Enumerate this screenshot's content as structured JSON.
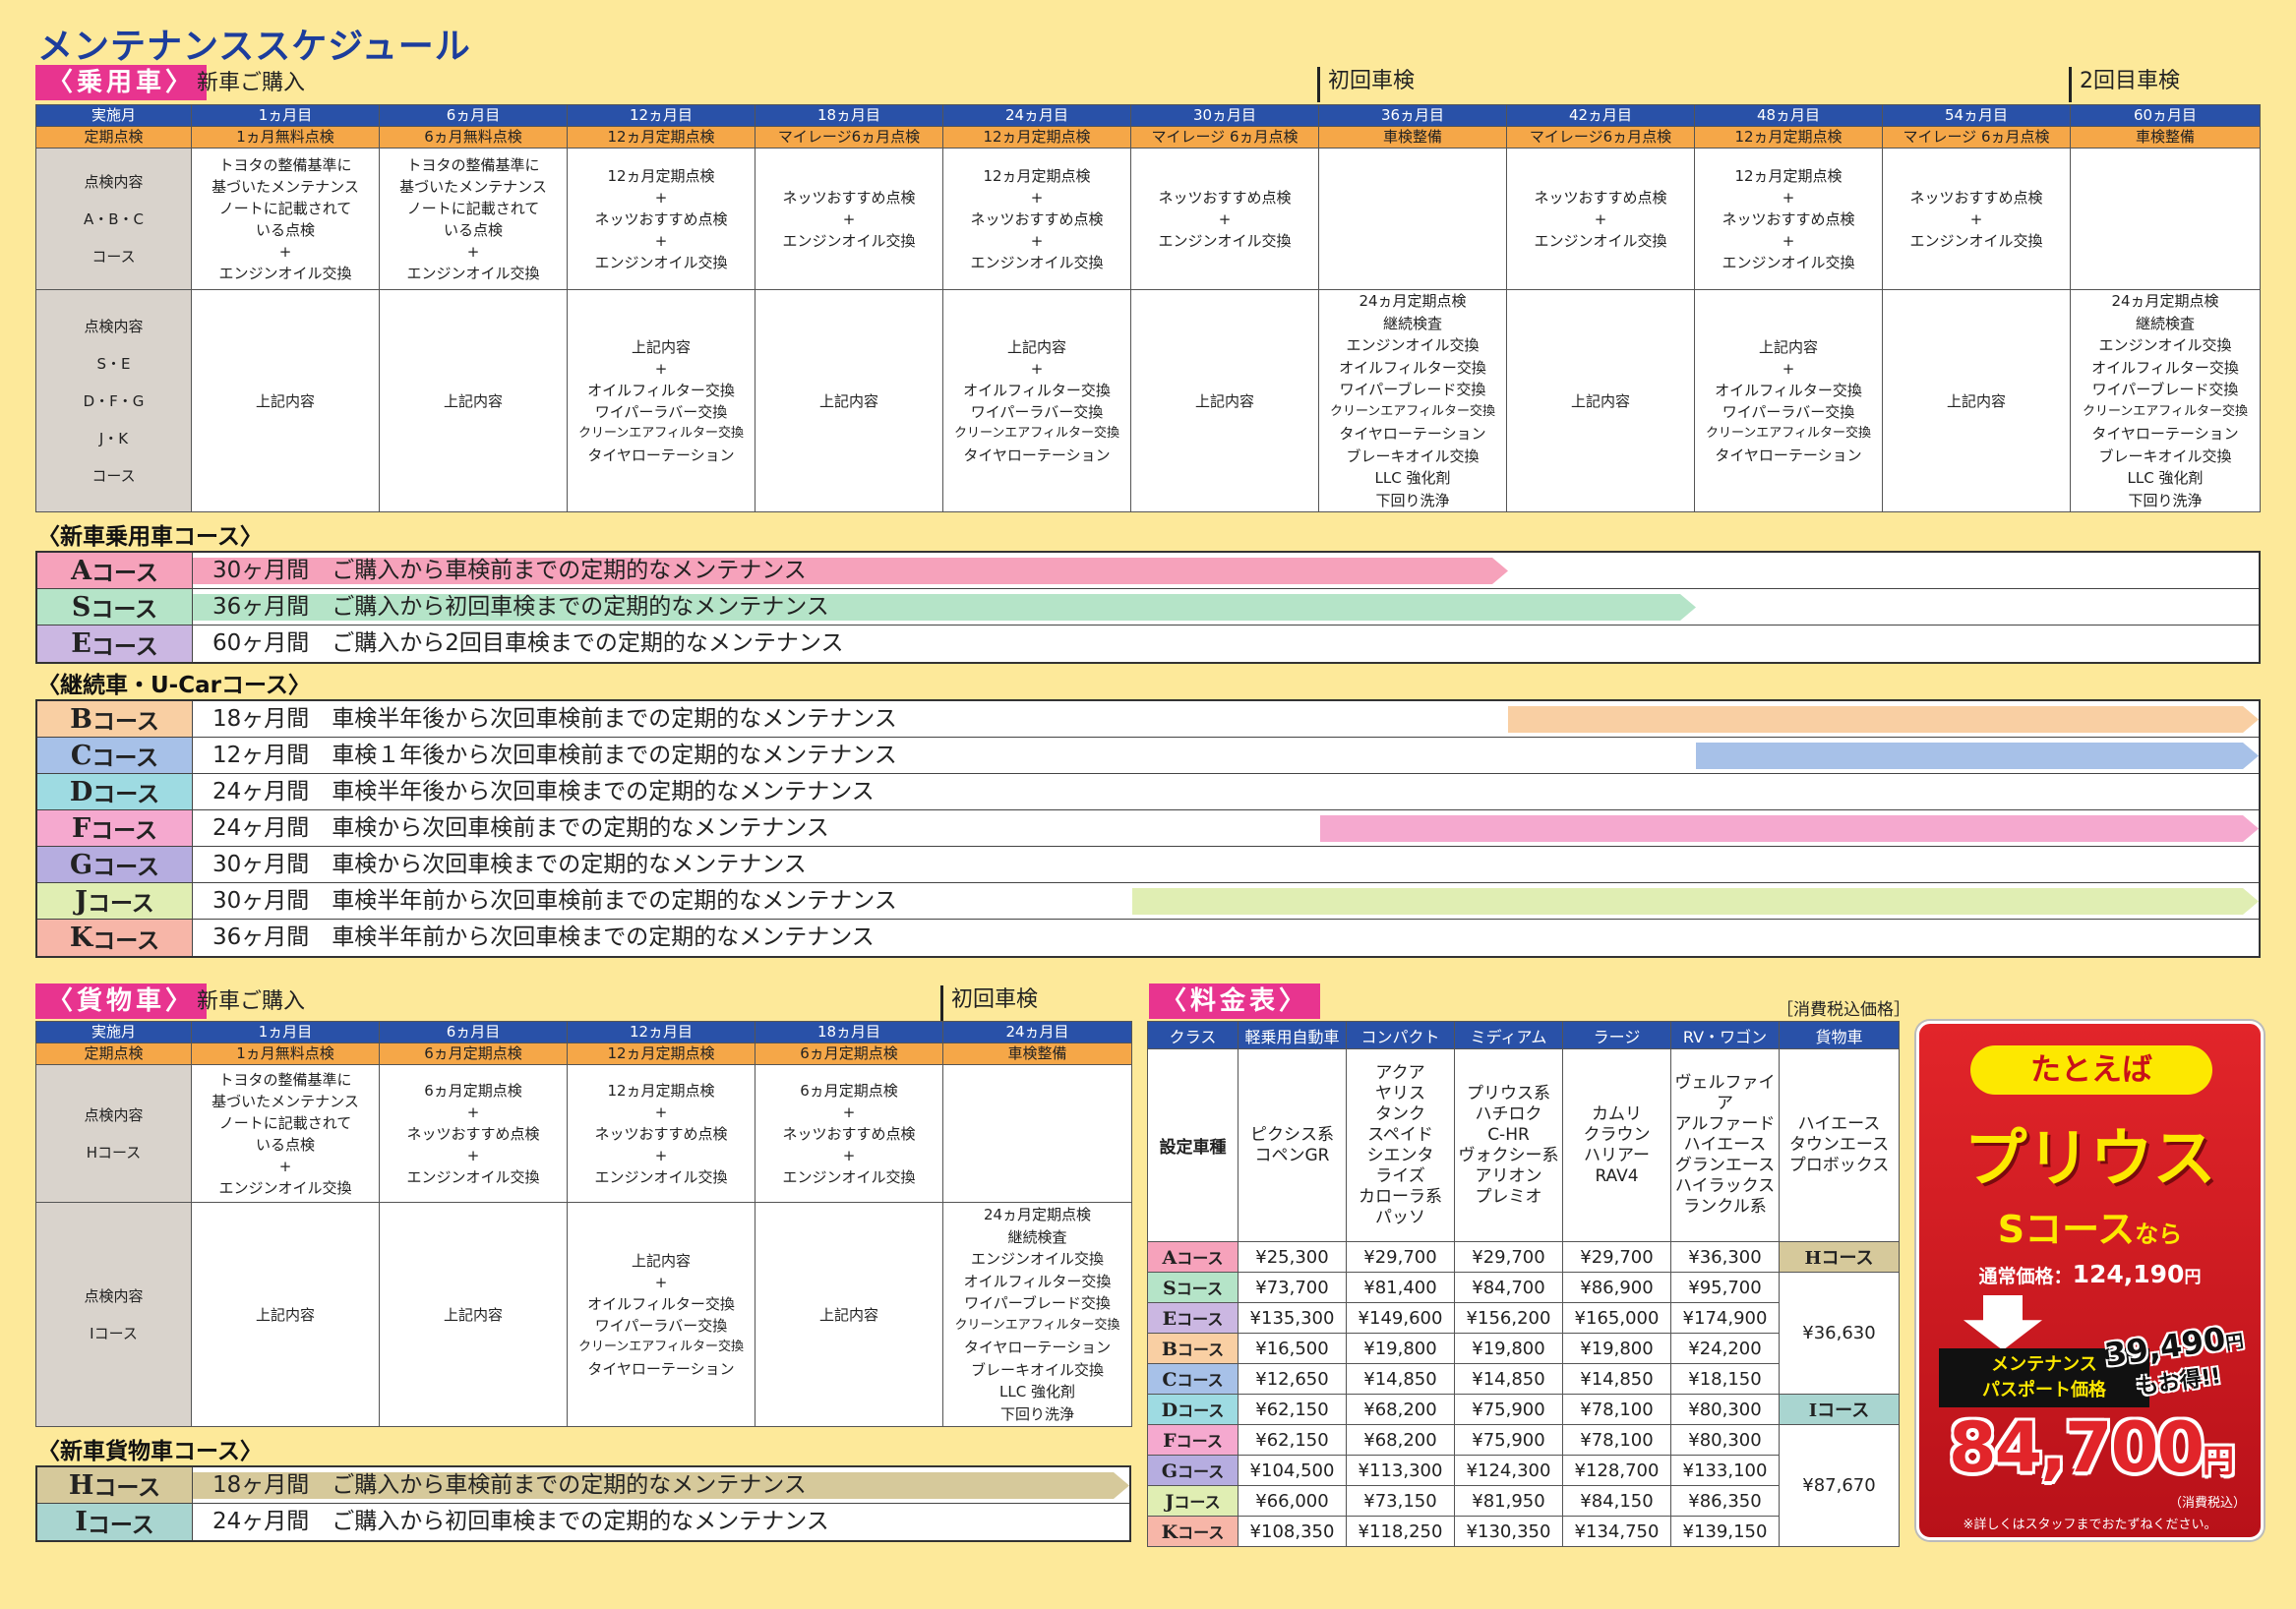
{
  "page_title": "メンテナンススケジュール",
  "passenger": {
    "label": "〈乗用車〉",
    "new_purchase": "新車ご購入",
    "first_inspection": "初回車検",
    "second_inspection": "2回目車検",
    "header_months": [
      "実施月",
      "1ヵ月目",
      "6ヵ月目",
      "12ヵ月目",
      "18ヵ月目",
      "24ヵ月目",
      "30ヵ月目",
      "36ヵ月目",
      "42ヵ月目",
      "48ヵ月目",
      "54ヵ月目",
      "60ヵ月目"
    ],
    "header_types": [
      "定期点検",
      "1ヵ月無料点検",
      "6ヵ月無料点検",
      "12ヵ月定期点検",
      "マイレージ6ヵ月点検",
      "12ヵ月定期点検",
      "マイレージ 6ヵ月点検",
      "車検整備",
      "マイレージ6ヵ月点検",
      "12ヵ月定期点検",
      "マイレージ 6ヵ月点検",
      "車検整備"
    ],
    "row1_label": [
      "点検内容",
      "A・B・C",
      "コース"
    ],
    "row1": [
      [
        "トヨタの整備基準に",
        "基づいたメンテナンス",
        "ノートに記載されて",
        "いる点検",
        "+",
        "エンジンオイル交換"
      ],
      [
        "トヨタの整備基準に",
        "基づいたメンテナンス",
        "ノートに記載されて",
        "いる点検",
        "+",
        "エンジンオイル交換"
      ],
      [
        "12ヵ月定期点検",
        "+",
        "ネッツおすすめ点検",
        "+",
        "エンジンオイル交換"
      ],
      [
        "ネッツおすすめ点検",
        "+",
        "エンジンオイル交換"
      ],
      [
        "12ヵ月定期点検",
        "+",
        "ネッツおすすめ点検",
        "+",
        "エンジンオイル交換"
      ],
      [
        "ネッツおすすめ点検",
        "+",
        "エンジンオイル交換"
      ],
      [],
      [
        "ネッツおすすめ点検",
        "+",
        "エンジンオイル交換"
      ],
      [
        "12ヵ月定期点検",
        "+",
        "ネッツおすすめ点検",
        "+",
        "エンジンオイル交換"
      ],
      [
        "ネッツおすすめ点検",
        "+",
        "エンジンオイル交換"
      ],
      []
    ],
    "row2_label": [
      "点検内容",
      "S・E",
      "D・F・G",
      "J・K",
      "コース"
    ],
    "row2": [
      [
        "上記内容"
      ],
      [
        "上記内容"
      ],
      [
        "上記内容",
        "+",
        "オイルフィルター交換",
        "ワイパーラバー交換",
        "クリーンエアフィルター交換",
        "タイヤローテーション"
      ],
      [
        "上記内容"
      ],
      [
        "上記内容",
        "+",
        "オイルフィルター交換",
        "ワイパーラバー交換",
        "クリーンエアフィルター交換",
        "タイヤローテーション"
      ],
      [
        "上記内容"
      ],
      [
        "24ヵ月定期点検",
        "継続検査",
        "エンジンオイル交換",
        "オイルフィルター交換",
        "ワイパーブレード交換",
        "クリーンエアフィルター交換",
        "タイヤローテーション",
        "ブレーキオイル交換",
        "LLC 強化剤",
        "下回り洗浄"
      ],
      [
        "上記内容"
      ],
      [
        "上記内容",
        "+",
        "オイルフィルター交換",
        "ワイパーラバー交換",
        "クリーンエアフィルター交換",
        "タイヤローテーション"
      ],
      [
        "上記内容"
      ],
      [
        "24ヵ月定期点検",
        "継続検査",
        "エンジンオイル交換",
        "オイルフィルター交換",
        "ワイパーブレード交換",
        "クリーンエアフィルター交換",
        "タイヤローテーション",
        "ブレーキオイル交換",
        "LLC 強化剤",
        "下回り洗浄"
      ]
    ]
  },
  "new_passenger_courses": {
    "heading": "〈新車乗用車コース〉",
    "items": [
      {
        "letter": "A",
        "suffix": "コース",
        "desc": "30ヶ月間　ご購入から車検前までの定期的なメンテナンス",
        "color": "#f6a2bb",
        "from": 0,
        "to": 6
      },
      {
        "letter": "S",
        "suffix": "コース",
        "desc": "36ヶ月間　ご購入から初回車検までの定期的なメンテナンス",
        "color": "#b5e4c8",
        "from": 0,
        "to": 7
      },
      {
        "letter": "E",
        "suffix": "コース",
        "desc": "60ヶ月間　ご購入から2回目車検までの定期的なメンテナンス",
        "color": "#cbb7e2",
        "from": 0,
        "to": 11
      }
    ]
  },
  "continuing_courses": {
    "heading": "〈継続車・U-Carコース〉",
    "items": [
      {
        "letter": "B",
        "suffix": "コース",
        "desc": "18ヶ月間　車検半年後から次回車検前までの定期的なメンテナンス",
        "color": "#f9cfa3",
        "from": 7,
        "to": 10
      },
      {
        "letter": "C",
        "suffix": "コース",
        "desc": "12ヶ月間　車検１年後から次回車検前までの定期的なメンテナンス",
        "color": "#a7c1e8",
        "from": 8,
        "to": 10
      },
      {
        "letter": "D",
        "suffix": "コース",
        "desc": "24ヶ月間　車検半年後から次回車検までの定期的なメンテナンス",
        "color": "#9edbe2",
        "from": 7,
        "to": 11
      },
      {
        "letter": "F",
        "suffix": "コース",
        "desc": "24ヶ月間　車検から次回車検前までの定期的なメンテナンス",
        "color": "#f5a9cf",
        "from": 6,
        "to": 10
      },
      {
        "letter": "G",
        "suffix": "コース",
        "desc": "30ヶ月間　車検から次回車検までの定期的なメンテナンス",
        "color": "#b6ade0",
        "from": 6,
        "to": 11
      },
      {
        "letter": "J",
        "suffix": "コース",
        "desc": "30ヶ月間　車検半年前から次回車検前までの定期的なメンテナンス",
        "color": "#e0eeb3",
        "from": 5,
        "to": 10
      },
      {
        "letter": "K",
        "suffix": "コース",
        "desc": "36ヶ月間　車検半年前から次回車検までの定期的なメンテナンス",
        "color": "#f7b6a8",
        "from": 5,
        "to": 11
      }
    ]
  },
  "cargo": {
    "label": "〈貨物車〉",
    "new_purchase": "新車ご購入",
    "first_inspection": "初回車検",
    "header_months": [
      "実施月",
      "1ヵ月目",
      "6ヵ月目",
      "12ヵ月目",
      "18ヵ月目",
      "24ヵ月目"
    ],
    "header_types": [
      "定期点検",
      "1ヵ月無料点検",
      "6ヵ月定期点検",
      "12ヵ月定期点検",
      "6ヵ月定期点検",
      "車検整備"
    ],
    "row1_label": [
      "点検内容",
      "Hコース"
    ],
    "row1": [
      [
        "トヨタの整備基準に",
        "基づいたメンテナンス",
        "ノートに記載されて",
        "いる点検",
        "+",
        "エンジンオイル交換"
      ],
      [
        "6ヵ月定期点検",
        "+",
        "ネッツおすすめ点検",
        "+",
        "エンジンオイル交換"
      ],
      [
        "12ヵ月定期点検",
        "+",
        "ネッツおすすめ点検",
        "+",
        "エンジンオイル交換"
      ],
      [
        "6ヵ月定期点検",
        "+",
        "ネッツおすすめ点検",
        "+",
        "エンジンオイル交換"
      ],
      []
    ],
    "row2_label": [
      "点検内容",
      "Iコース"
    ],
    "row2": [
      [
        "上記内容"
      ],
      [
        "上記内容"
      ],
      [
        "上記内容",
        "+",
        "オイルフィルター交換",
        "ワイパーラバー交換",
        "クリーンエアフィルター交換",
        "タイヤローテーション"
      ],
      [
        "上記内容"
      ],
      [
        "24ヵ月定期点検",
        "継続検査",
        "エンジンオイル交換",
        "オイルフィルター交換",
        "ワイパーブレード交換",
        "クリーンエアフィルター交換",
        "タイヤローテーション",
        "ブレーキオイル交換",
        "LLC 強化剤",
        "下回り洗浄"
      ]
    ]
  },
  "new_cargo_courses": {
    "heading": "〈新車貨物車コース〉",
    "items": [
      {
        "letter": "H",
        "suffix": "コース",
        "desc": "18ヶ月間　ご購入から車検前までの定期的なメンテナンス",
        "color": "#d6c99b",
        "from": 0,
        "to": 4
      },
      {
        "letter": "I",
        "suffix": "コース",
        "desc": "24ヶ月間　ご購入から初回車検までの定期的なメンテナンス",
        "color": "#a9d5d0",
        "from": 0,
        "to": 5
      }
    ]
  },
  "price": {
    "label": "〈料金表〉",
    "tax_note": "［消費税込価格］",
    "headers": [
      "クラス",
      "軽乗用自動車",
      "コンパクト",
      "ミディアム",
      "ラージ",
      "RV・ワゴン",
      "貨物車"
    ],
    "model_row_label": "設定車種",
    "models": [
      [
        "ピクシス系",
        "コペンGR"
      ],
      [
        "アクア",
        "ヤリス",
        "タンク",
        "スペイド",
        "シエンタ",
        "ライズ",
        "カローラ系",
        "パッソ"
      ],
      [
        "プリウス系",
        "ハチロク",
        "C-HR",
        "ヴォクシー系",
        "アリオン",
        "プレミオ"
      ],
      [
        "カムリ",
        "クラウン",
        "ハリアー",
        "RAV4"
      ],
      [
        "ヴェルファイア",
        "アルファード",
        "ハイエース",
        "グランエース",
        "ハイラックス",
        "ランクル系"
      ],
      [
        "ハイエース",
        "タウンエース",
        "プロボックス"
      ]
    ],
    "rows": [
      {
        "letter": "A",
        "color": "#f6a2bb",
        "prices": [
          "¥25,300",
          "¥29,700",
          "¥29,700",
          "¥29,700",
          "¥36,300"
        ]
      },
      {
        "letter": "S",
        "color": "#b5e4c8",
        "prices": [
          "¥73,700",
          "¥81,400",
          "¥84,700",
          "¥86,900",
          "¥95,700"
        ]
      },
      {
        "letter": "E",
        "color": "#cbb7e2",
        "prices": [
          "¥135,300",
          "¥149,600",
          "¥156,200",
          "¥165,000",
          "¥174,900"
        ]
      },
      {
        "letter": "B",
        "color": "#f9cfa3",
        "prices": [
          "¥16,500",
          "¥19,800",
          "¥19,800",
          "¥19,800",
          "¥24,200"
        ]
      },
      {
        "letter": "C",
        "color": "#a7c1e8",
        "prices": [
          "¥12,650",
          "¥14,850",
          "¥14,850",
          "¥14,850",
          "¥18,150"
        ]
      },
      {
        "letter": "D",
        "color": "#9edbe2",
        "prices": [
          "¥62,150",
          "¥68,200",
          "¥75,900",
          "¥78,100",
          "¥80,300"
        ]
      },
      {
        "letter": "F",
        "color": "#f5a9cf",
        "prices": [
          "¥62,150",
          "¥68,200",
          "¥75,900",
          "¥78,100",
          "¥80,300"
        ]
      },
      {
        "letter": "G",
        "color": "#b6ade0",
        "prices": [
          "¥104,500",
          "¥113,300",
          "¥124,300",
          "¥128,700",
          "¥133,100"
        ]
      },
      {
        "letter": "J",
        "color": "#e0eeb3",
        "prices": [
          "¥66,000",
          "¥73,150",
          "¥81,950",
          "¥84,150",
          "¥86,350"
        ]
      },
      {
        "letter": "K",
        "color": "#f7b6a8",
        "prices": [
          "¥108,350",
          "¥118,250",
          "¥130,350",
          "¥134,750",
          "¥139,150"
        ]
      }
    ],
    "cargo": {
      "h_label": "Hコース",
      "h_color": "#d6c99b",
      "h_price": "¥36,630",
      "i_label": "Ⅰコース",
      "i_color": "#a9d5d0",
      "i_price": "¥87,670"
    },
    "suffix": "コース"
  },
  "promo": {
    "tag": "たとえば",
    "model": "プリウス",
    "course": "Sコース",
    "nara": "なら",
    "normal_label": "通常価格：",
    "normal_price": "124,190",
    "yen": "円",
    "save_amount": "39,490",
    "save_yen": "円",
    "save_text": "もお得!!",
    "passport_label": [
      "メンテナンス",
      "パスポート価格"
    ],
    "price": "84,700",
    "price_yen": "円",
    "tax": "（消費税込）",
    "note": "※詳しくはスタッフまでおたずねください。"
  }
}
